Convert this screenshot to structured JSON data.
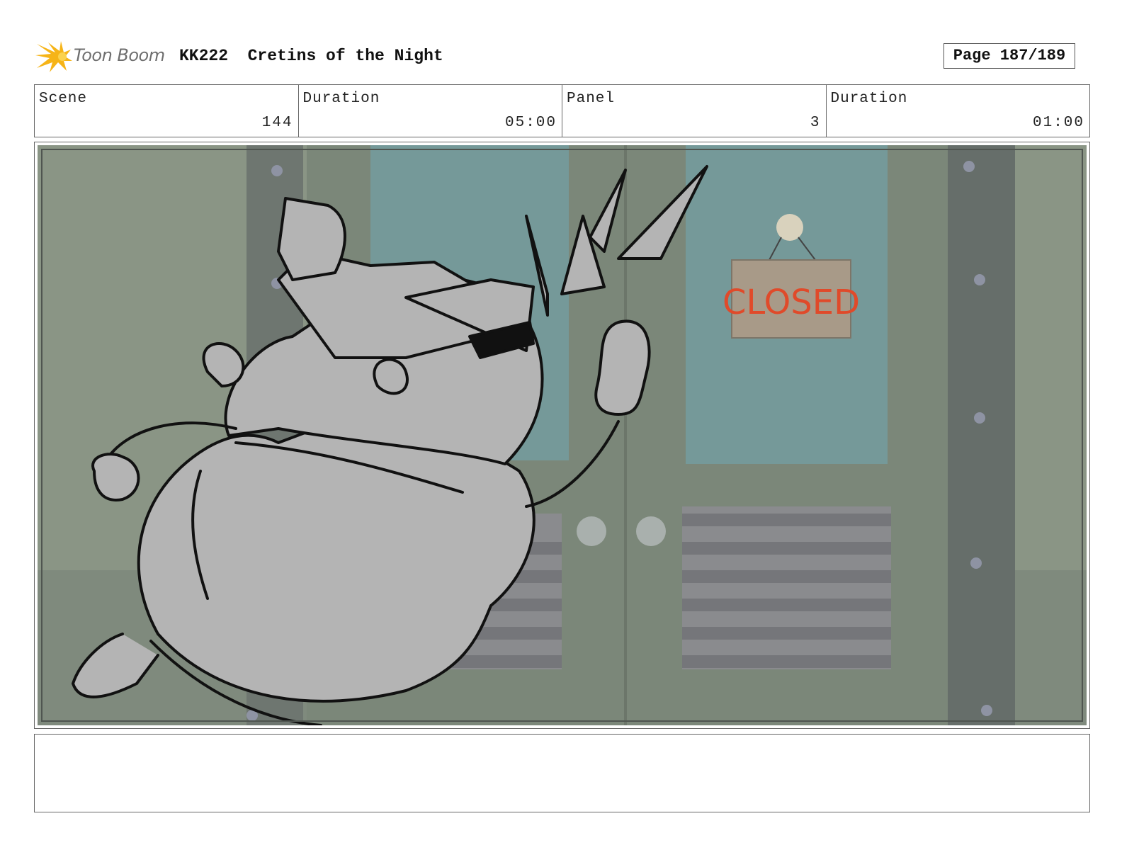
{
  "header": {
    "logo_text": "Toon Boom",
    "production_code": "KK222",
    "episode_title": "Cretins of the Night",
    "page_label": "Page 187/189"
  },
  "info": {
    "scene_label": "Scene",
    "scene_value": "144",
    "scene_duration_label": "Duration",
    "scene_duration_value": "05:00",
    "panel_label": "Panel",
    "panel_value": "3",
    "panel_duration_label": "Duration",
    "panel_duration_value": "01:00"
  },
  "artwork": {
    "sign_text": "CLOSED"
  },
  "notes": {
    "text": ""
  }
}
